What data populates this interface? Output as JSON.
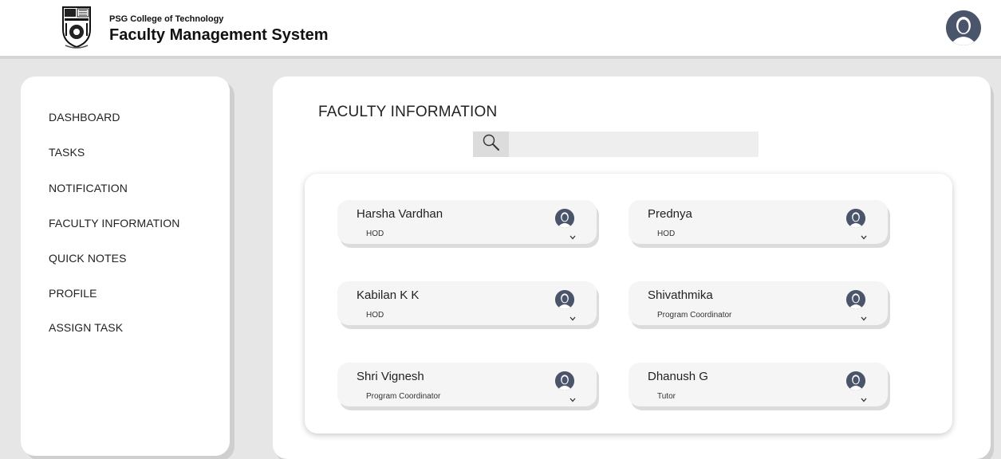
{
  "header": {
    "college": "PSG College of Technology",
    "app_title": "Faculty Management System",
    "logo_icon": "college-crest-icon",
    "avatar_icon": "user-avatar-icon"
  },
  "sidebar": {
    "items": [
      {
        "label": "DASHBOARD"
      },
      {
        "label": "TASKS"
      },
      {
        "label": "NOTIFICATION"
      },
      {
        "label": "FACULTY INFORMATION"
      },
      {
        "label": "QUICK NOTES"
      },
      {
        "label": "PROFILE"
      },
      {
        "label": "ASSIGN TASK"
      }
    ]
  },
  "main": {
    "title": "FACULTY INFORMATION",
    "search": {
      "icon": "search-icon",
      "value": "",
      "placeholder": ""
    },
    "faculty": [
      {
        "name": "Harsha Vardhan",
        "role": "HOD"
      },
      {
        "name": "Prednya",
        "role": "HOD"
      },
      {
        "name": "Kabilan K K",
        "role": "HOD"
      },
      {
        "name": "Shivathmika",
        "role": "Program Coordinator"
      },
      {
        "name": "Shri Vignesh",
        "role": "Program Coordinator"
      },
      {
        "name": "Dhanush G",
        "role": "Tutor"
      }
    ]
  },
  "colors": {
    "avatar": "#4a556b",
    "background": "#e6e6e6",
    "card": "#f5f5f5"
  }
}
